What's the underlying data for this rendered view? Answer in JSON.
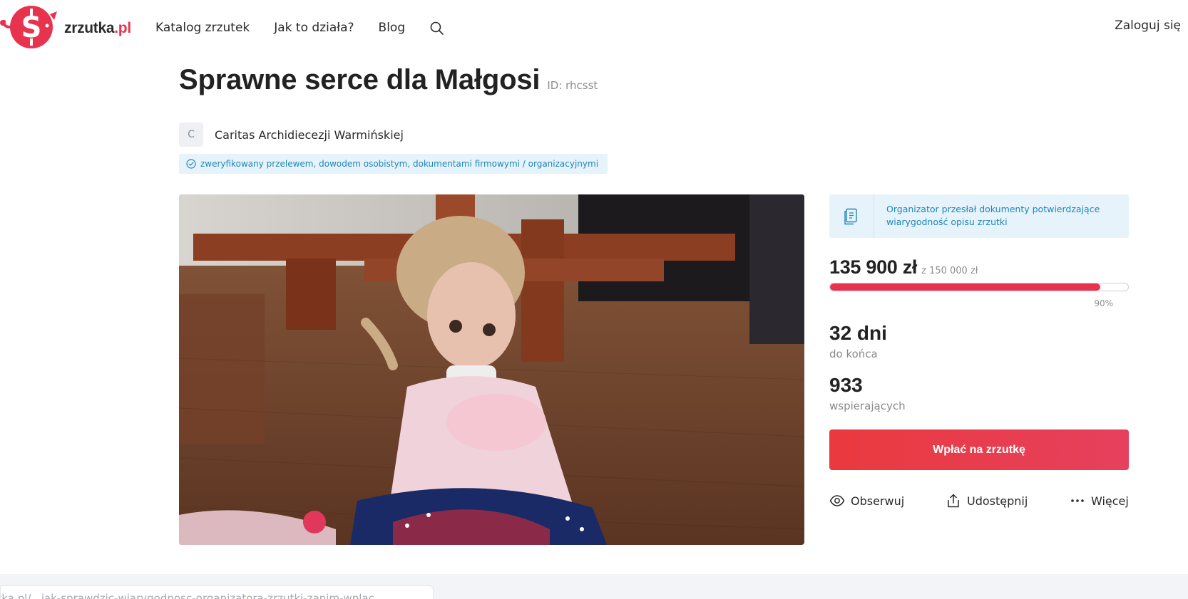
{
  "header": {
    "logo_text": "zrzutka",
    "logo_suffix": ".pl",
    "nav": [
      "Katalog zrzutek",
      "Jak to działa?",
      "Blog"
    ],
    "search_icon": "search-icon",
    "login_label": "Zaloguj się"
  },
  "campaign": {
    "title": "Sprawne serce dla Małgosi",
    "id_label": "ID: rhcsst",
    "organizer_initial": "C",
    "organizer_name": "Caritas Archidiecezji Warmińskiej",
    "verified_text": "zweryfikowany przelewem, dowodem osobistym, dokumentami firmowymi / organizacyjnymi",
    "photo": "photo of a little girl sitting on a wooden floor holding a pink cloth"
  },
  "panel": {
    "documents_note": "Organizator przesłał dokumenty potwierdzające wiarygodność opisu zrzutki",
    "raised": "135 900 zł",
    "goal": "z 150 000 zł",
    "progress_fraction": 0.906,
    "progress_label": "90%",
    "days_value": "32 dni",
    "days_label": "do końca",
    "supporters_value": "933",
    "supporters_label": "wspierających",
    "donate_label": "Wpłać na zrzutkę",
    "actions": [
      {
        "label": "Obserwuj",
        "icon": "eye-icon"
      },
      {
        "label": "Udostępnij",
        "icon": "share-icon"
      },
      {
        "label": "Więcej",
        "icon": "more-dots-icon"
      }
    ]
  },
  "footer": {
    "url_text": "utka.pl/...jak-sprawdzic-wiarygodnosc-organizatora-zrzutki-zanim-wplac..."
  },
  "colors": {
    "accent": "#e8334f",
    "info_bg": "#e6f3fa",
    "info_text": "#1f86b8",
    "text": "#222222",
    "muted": "#8e8e8e"
  }
}
